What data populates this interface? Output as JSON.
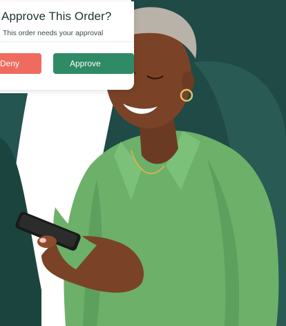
{
  "approval_card": {
    "title": "Approve This Order?",
    "subtitle": "This order needs your approval",
    "deny_label": "Deny",
    "approve_label": "Approve"
  },
  "colors": {
    "brand_dark": "#1f4a45",
    "brand_mid": "#2a5a54",
    "deny": "#ef6b5e",
    "approve": "#2f8a66",
    "shirt": "#6cb06a"
  },
  "icons": {
    "person_photo": "woman-using-phone-photo",
    "phone": "smartphone-icon"
  }
}
